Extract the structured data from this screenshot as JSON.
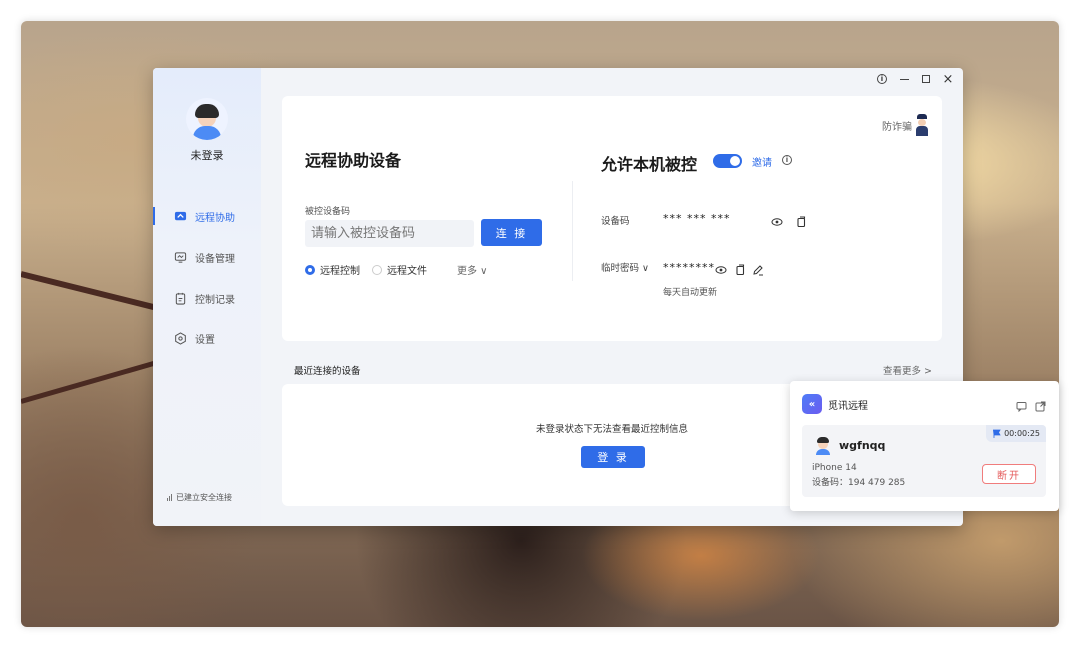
{
  "window_controls": {
    "info": "i",
    "minimize": "–",
    "maximize": "□",
    "close": "×"
  },
  "sidebar": {
    "login_status": "未登录",
    "items": [
      {
        "label": "远程协助",
        "icon": "remote-assist-icon",
        "active": true
      },
      {
        "label": "设备管理",
        "icon": "device-manage-icon",
        "active": false
      },
      {
        "label": "控制记录",
        "icon": "control-log-icon",
        "active": false
      },
      {
        "label": "设置",
        "icon": "settings-icon",
        "active": false
      }
    ],
    "connection_status": "已建立安全连接"
  },
  "main": {
    "anti_fraud": "防诈骗",
    "remote_assist": {
      "title": "远程协助设备",
      "field_label": "被控设备码",
      "input_placeholder": "请输入被控设备码",
      "connect_label": "连 接",
      "options": [
        {
          "label": "远程控制",
          "selected": true
        },
        {
          "label": "远程文件",
          "selected": false
        }
      ],
      "more_label": "更多 ∨"
    },
    "allow_control": {
      "title": "允许本机被控",
      "toggle_on": true,
      "invite_label": "邀请",
      "device_code_label": "设备码",
      "device_code_value": "*** *** ***",
      "temp_password_label": "临时密码 ∨",
      "temp_password_value": "********",
      "auto_update_note": "每天自动更新"
    },
    "recent": {
      "title": "最近连接的设备",
      "view_more": "查看更多 >",
      "empty_message": "未登录状态下无法查看最近控制信息",
      "login_label": "登 录"
    }
  },
  "popup": {
    "app_name": "觅讯远程",
    "timer": "00:00:25",
    "username": "wgfnqq",
    "device_model": "iPhone 14",
    "device_code": "设备码：194 479 285",
    "disconnect_label": "断开"
  },
  "colors": {
    "accent": "#2f6ce8",
    "danger": "#e45a5a"
  }
}
